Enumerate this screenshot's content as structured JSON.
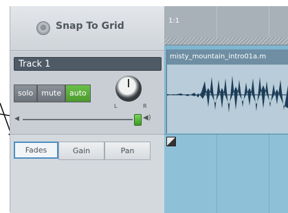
{
  "snap": {
    "label": "Snap To Grid"
  },
  "track": {
    "name": "Track 1",
    "buttons": {
      "solo": "solo",
      "mute": "mute",
      "auto": "auto"
    },
    "pan": {
      "left": "L",
      "right": "R"
    }
  },
  "modes": {
    "fades": "Fades",
    "gain": "Gain",
    "pan": "Pan",
    "selected": "Fades"
  },
  "timeline": {
    "ruler_mark": "1:1"
  },
  "clip": {
    "name": "misty_mountain_intro01a.m"
  },
  "colors": {
    "auto_active": "#5cb43b",
    "track_name_bg": "#4e5a66",
    "timeline_bg": "#7fb6d0",
    "selection_border": "#4a8ec2"
  },
  "icons": {
    "snap": "radio-button-icon",
    "vol_low": "speaker-low-icon",
    "vol_high": "speaker-high-icon",
    "fade": "fade-handle-icon"
  }
}
